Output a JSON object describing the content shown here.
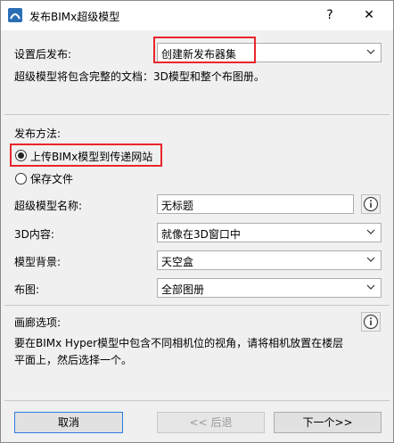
{
  "window": {
    "title": "发布BIMx超级模型",
    "help_glyph": "?",
    "close_glyph": "✕",
    "icon": "bimx-app-icon"
  },
  "publish_settings": {
    "label": "设置后发布:",
    "selected": "创建新发布器集",
    "description": "超级模型将包含完整的文档：3D模型和整个布图册。"
  },
  "publish_method": {
    "label": "发布方法:",
    "options": [
      {
        "label": "上传BIMx模型到传递网站",
        "selected": true
      },
      {
        "label": "保存文件",
        "selected": false
      }
    ]
  },
  "fields": {
    "model_name": {
      "label": "超级模型名称:",
      "value": "无标题"
    },
    "content_3d": {
      "label": "3D内容:",
      "value": "就像在3D窗口中"
    },
    "background": {
      "label": "模型背景:",
      "value": "天空盒"
    },
    "layout": {
      "label": "布图:",
      "value": "全部图册"
    }
  },
  "gallery": {
    "label": "画廊选项:",
    "description_line1": "要在BIMx Hyper模型中包含不同相机位的视角，请将相机放置在楼层",
    "description_line2": "平面上，然后选择一个。"
  },
  "buttons": {
    "cancel": "取消",
    "back": "<< 后退",
    "next": "下一个>>"
  },
  "colors": {
    "highlight": "#e8262b",
    "dialog_bg": "#f0f0f0",
    "app_icon": "#2a6fb5"
  }
}
